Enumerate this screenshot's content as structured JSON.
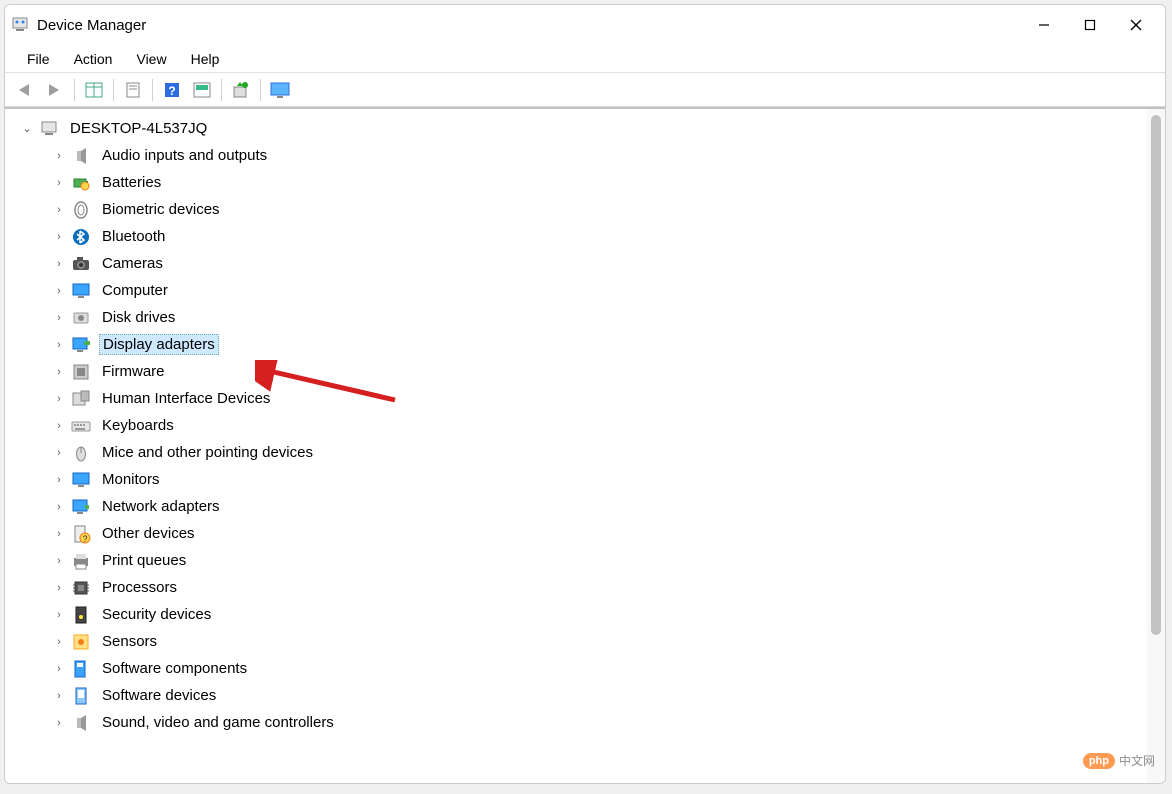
{
  "window": {
    "title": "Device Manager"
  },
  "menu": {
    "items": [
      "File",
      "Action",
      "View",
      "Help"
    ]
  },
  "toolbar": {
    "buttons": [
      {
        "name": "back-button",
        "icon": "arrow-left"
      },
      {
        "name": "forward-button",
        "icon": "arrow-right"
      },
      {
        "name": "show-hidden-button",
        "icon": "grid"
      },
      {
        "name": "properties-button",
        "icon": "sheet"
      },
      {
        "name": "help-button",
        "icon": "help"
      },
      {
        "name": "scan-hardware-button",
        "icon": "scan"
      },
      {
        "name": "add-driver-button",
        "icon": "add-driver"
      },
      {
        "name": "monitor-button",
        "icon": "monitor"
      }
    ]
  },
  "tree": {
    "root": {
      "label": "DESKTOP-4L537JQ",
      "icon": "computer-root",
      "expanded": true
    },
    "categories": [
      {
        "label": "Audio inputs and outputs",
        "icon": "speaker-icon"
      },
      {
        "label": "Batteries",
        "icon": "battery-icon"
      },
      {
        "label": "Biometric devices",
        "icon": "fingerprint-icon"
      },
      {
        "label": "Bluetooth",
        "icon": "bluetooth-icon"
      },
      {
        "label": "Cameras",
        "icon": "camera-icon"
      },
      {
        "label": "Computer",
        "icon": "monitor-icon"
      },
      {
        "label": "Disk drives",
        "icon": "disk-icon"
      },
      {
        "label": "Display adapters",
        "icon": "display-adapter-icon",
        "selected": true
      },
      {
        "label": "Firmware",
        "icon": "firmware-icon"
      },
      {
        "label": "Human Interface Devices",
        "icon": "hid-icon"
      },
      {
        "label": "Keyboards",
        "icon": "keyboard-icon"
      },
      {
        "label": "Mice and other pointing devices",
        "icon": "mouse-icon"
      },
      {
        "label": "Monitors",
        "icon": "monitor-icon"
      },
      {
        "label": "Network adapters",
        "icon": "network-icon"
      },
      {
        "label": "Other devices",
        "icon": "other-device-icon"
      },
      {
        "label": "Print queues",
        "icon": "printer-icon"
      },
      {
        "label": "Processors",
        "icon": "cpu-icon"
      },
      {
        "label": "Security devices",
        "icon": "security-icon"
      },
      {
        "label": "Sensors",
        "icon": "sensor-icon"
      },
      {
        "label": "Software components",
        "icon": "software-component-icon"
      },
      {
        "label": "Software devices",
        "icon": "software-device-icon"
      },
      {
        "label": "Sound, video and game controllers",
        "icon": "sound-icon"
      }
    ]
  },
  "watermark": {
    "badge": "php",
    "text": "中文网"
  }
}
